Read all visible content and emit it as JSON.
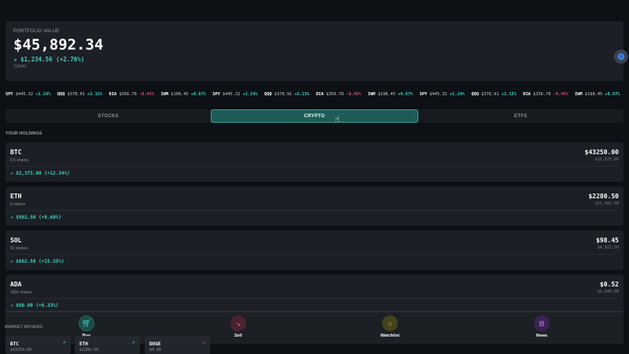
{
  "portfolio": {
    "label": "PORTFOLIO VALUE",
    "value": "$45,892.34",
    "change": "$1,234.56 (+2.76%)",
    "period": "TODAY"
  },
  "ticker": [
    {
      "sym": "SPY",
      "price": "$445.32",
      "chg": "+1.24%",
      "dir": "up"
    },
    {
      "sym": "QQQ",
      "price": "$378.91",
      "chg": "+2.15%",
      "dir": "up"
    },
    {
      "sym": "DIA",
      "price": "$356.78",
      "chg": "-0.45%",
      "dir": "down"
    },
    {
      "sym": "IWM",
      "price": "$198.45",
      "chg": "+0.87%",
      "dir": "up"
    },
    {
      "sym": "SPY",
      "price": "$445.32",
      "chg": "+1.24%",
      "dir": "up"
    },
    {
      "sym": "QQQ",
      "price": "$378.91",
      "chg": "+2.15%",
      "dir": "up"
    },
    {
      "sym": "DIA",
      "price": "$356.78",
      "chg": "-0.45%",
      "dir": "down"
    },
    {
      "sym": "IWM",
      "price": "$198.45",
      "chg": "+0.87%",
      "dir": "up"
    },
    {
      "sym": "SPY",
      "price": "$445.32",
      "chg": "+1.24%",
      "dir": "up"
    },
    {
      "sym": "QQQ",
      "price": "$378.91",
      "chg": "+2.15%",
      "dir": "up"
    },
    {
      "sym": "DIA",
      "price": "$356.78",
      "chg": "-0.45%",
      "dir": "down"
    },
    {
      "sym": "IWM",
      "price": "$198.45",
      "chg": "+0.87%",
      "dir": "up"
    }
  ],
  "tabs": {
    "stocks": "STOCKS",
    "crypto": "CRYPTO",
    "etfs": "ETFS"
  },
  "holdings_label": "YOUR HOLDINGS",
  "holdings": [
    {
      "sym": "BTC",
      "shares": "0.5 shares",
      "price": "$43250.00",
      "value": "$21,625.00",
      "gain": "$2,375.00 (+12.34%)"
    },
    {
      "sym": "ETH",
      "shares": "5 shares",
      "price": "$2280.50",
      "value": "$11,402.50",
      "gain": "$902.50 (+8.60%)"
    },
    {
      "sym": "SOL",
      "shares": "50 shares",
      "price": "$98.45",
      "value": "$4,922.50",
      "gain": "$662.50 (+15.55%)"
    },
    {
      "sym": "ADA",
      "shares": "2000 shares",
      "price": "$0.52",
      "value": "$1,040.00",
      "gain": "$80.00 (+8.33%)"
    }
  ],
  "nav": {
    "buy": "Buy",
    "sell": "Sell",
    "watchlist": "Watchlist",
    "news": "News"
  },
  "movers_label": "MARKET MOVERS",
  "movers": [
    {
      "sym": "BTC",
      "price": "$43250.00"
    },
    {
      "sym": "ETH",
      "price": "$2280.50"
    },
    {
      "sym": "DOGE",
      "price": "$0.08"
    }
  ],
  "colors": {
    "accent": "#3fd1c1",
    "down": "#c8557a",
    "bg": "#0d1015",
    "card": "#1c1f25"
  }
}
